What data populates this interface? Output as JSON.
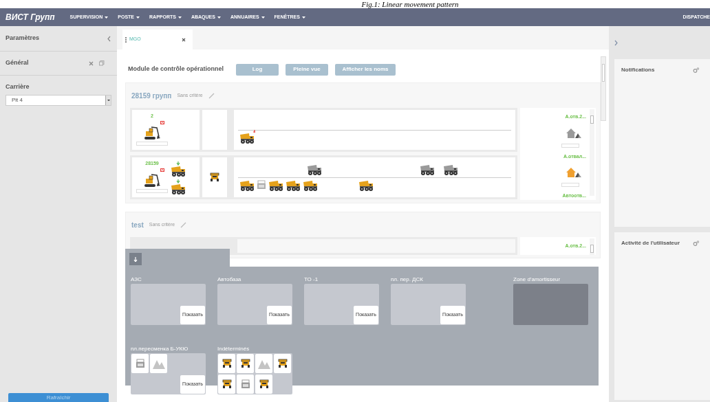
{
  "caption": "Fig.1: Linear movement pattern",
  "navbar": {
    "brand": "ВИСТ Групп",
    "menus": [
      "SUPERVISION",
      "POSTE",
      "RAPPORTS",
      "ABAQUES",
      "ANNUAIRES",
      "FENÊTRES"
    ],
    "user": "DISPATCHE"
  },
  "left_panel": {
    "title": "Paramètres",
    "section": "Général",
    "field_label": "Carrière",
    "select_value": "Pit 4",
    "button": "Rafraîchir"
  },
  "tabs": [
    {
      "label": "MGO",
      "selected": true
    }
  ],
  "module": {
    "title": "Module de contrôle opérationnel",
    "buttons": [
      "Log",
      "Pleine vue",
      "Afficher les noms"
    ]
  },
  "groups": [
    {
      "name": "28159 групп",
      "criteria": "Sans critère",
      "rows": [
        {
          "count": "2",
          "level": 0,
          "lower_lane": [
            {
              "kind": "dump-truck",
              "color": "#e5a21c",
              "alert": true
            }
          ]
        },
        {
          "count": "28159",
          "level": 0,
          "queue": [
            {
              "kind": "dump-truck",
              "color": "#e5a21c"
            },
            {
              "kind": "dump-truck",
              "color": "#e5a21c"
            }
          ],
          "bay": [
            {
              "kind": "truck-front",
              "color": "#e5a21c"
            }
          ],
          "upper_lane": [
            {
              "kind": "dump-truck",
              "color": "#9a9a9a"
            },
            {
              "kind": "dump-truck",
              "color": "#9a9a9a"
            },
            {
              "kind": "dump-truck",
              "color": "#9a9a9a"
            }
          ],
          "lower_lane": [
            {
              "kind": "dump-truck",
              "color": "#e5a21c"
            },
            {
              "kind": "machine",
              "color": "#b0b0b0"
            },
            {
              "kind": "dump-truck",
              "color": "#e5a21c"
            },
            {
              "kind": "dump-truck",
              "color": "#e5a21c"
            },
            {
              "kind": "dump-truck",
              "color": "#e5a21c"
            },
            {
              "kind": "dump-truck",
              "color": "#e5a21c"
            }
          ]
        }
      ],
      "destinations": [
        {
          "label": "А.отв.2...",
          "color": "#9a9a9a",
          "level": 0
        },
        {
          "label": "А.отвал...",
          "color": "#f0a030",
          "level": 0
        },
        {
          "label": "Автоотв..."
        }
      ]
    },
    {
      "name": "test",
      "criteria": "Sans critère",
      "destinations": [
        {
          "label": "А.отв.2..."
        }
      ]
    }
  ],
  "zones_panel": {
    "zones": [
      {
        "label": "АЗС",
        "kind": "zone",
        "button": "Показать"
      },
      {
        "label": "Автобаза",
        "kind": "zone",
        "button": "Показать"
      },
      {
        "label": "ТО -1",
        "kind": "zone",
        "button": "Показать"
      },
      {
        "label": "пл. пер. ДСК",
        "kind": "zone",
        "button": "Показать"
      },
      {
        "label": "Zone d'amortisseur",
        "kind": "buffer"
      },
      {
        "label": "пл.пересменка Б-УКЮ",
        "kind": "zone",
        "button": "Показать",
        "items": [
          {
            "kind": "machine",
            "color": "#9a9a9a"
          },
          {
            "kind": "dump"
          }
        ]
      },
      {
        "label": "Indéterminés",
        "kind": "zone",
        "items": [
          {
            "kind": "truck-front",
            "color": "#e5a21c"
          },
          {
            "kind": "truck-front",
            "color": "#e5a21c"
          },
          {
            "kind": "dump"
          },
          {
            "kind": "truck-front",
            "color": "#e5a21c"
          },
          {
            "kind": "truck-front",
            "color": "#e5a21c"
          },
          {
            "kind": "machine",
            "color": "#9a9a9a"
          },
          {
            "kind": "truck-front",
            "color": "#e5a21c"
          }
        ]
      }
    ]
  },
  "right_panel": {
    "cards": [
      "Notifications",
      "Activité de l'utilisateur"
    ]
  }
}
